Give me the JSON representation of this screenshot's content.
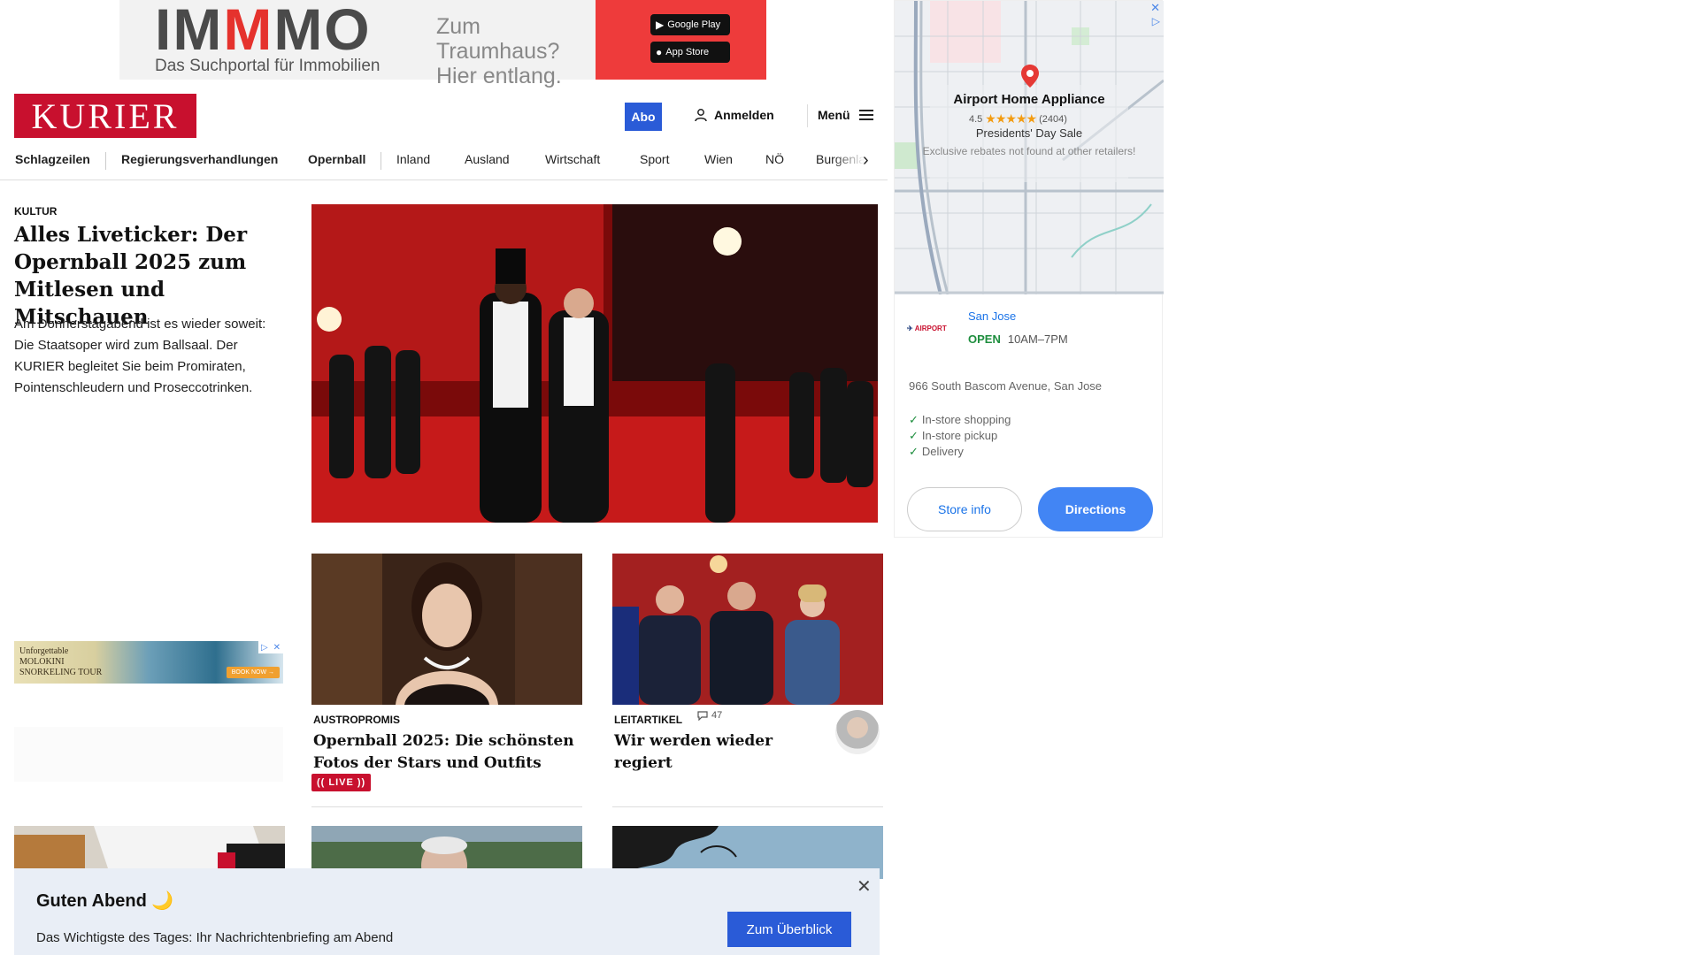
{
  "ad_top": {
    "brand": "IMMMO",
    "brand_sub": "Das Suchportal für Immobilien",
    "headline_1": "Zum Traumhaus?",
    "headline_2": "Hier entlang.",
    "google_play": "Google Play",
    "app_store": "App Store"
  },
  "header": {
    "logo": "KURIER",
    "abo": "Abo",
    "login": "Anmelden",
    "menu": "Menü"
  },
  "nav": {
    "items": [
      "Schlagzeilen",
      "Regierungsverhandlungen",
      "Opernball",
      "Inland",
      "Ausland",
      "Wirtschaft",
      "Sport",
      "Wien",
      "NÖ",
      "Burgenla"
    ]
  },
  "lead": {
    "kicker": "KULTUR",
    "title": "Alles Liveticker: Der Opernball 2025 zum Mitlesen und Mitschauen",
    "teaser": "Am Donnerstagabend ist es wieder soweit: Die Staatsoper wird zum Ballsaal. Der KURIER begleitet Sie beim Promiraten, Pointenschleudern und Proseccotrinken."
  },
  "side_ad": {
    "text_1": "Unforgettable",
    "text_2": "MOLOKINI",
    "text_3": "SNORKELING TOUR",
    "cta": "BOOK NOW →"
  },
  "cards": [
    {
      "kicker": "AUSTROPROMIS",
      "title": "Opernball 2025: Die schönsten Fotos der Stars und Outfits",
      "badge": "(( LIVE ))"
    },
    {
      "kicker": "LEITARTIKEL",
      "comments": "47",
      "title": "Wir werden wieder regiert"
    }
  ],
  "map_ad": {
    "store_name": "Airport Home Appliance",
    "rating": "4.5",
    "stars": "★★★★★",
    "reviews": "(2404)",
    "sale": "Presidents' Day Sale",
    "note": "Exclusive rebates not found at other retailers!",
    "logo_text": "AIRPORT",
    "city": "San Jose",
    "open": "OPEN",
    "hours": "10AM–7PM",
    "address": "966 South Bascom Avenue, San Jose",
    "features": [
      "In-store shopping",
      "In-store pickup",
      "Delivery"
    ],
    "store_info": "Store info",
    "directions": "Directions"
  },
  "newsletter": {
    "title": "Guten Abend 🌙",
    "text": "Das Wichtigste des Tages: Ihr Nachrichtenbriefing am Abend",
    "button": "Zum Überblick"
  },
  "colors": {
    "kurier_red": "#c8102e",
    "abo_blue": "#2a5bd7",
    "directions_blue": "#4285f4",
    "newsletter_bg": "#e9eef6"
  }
}
